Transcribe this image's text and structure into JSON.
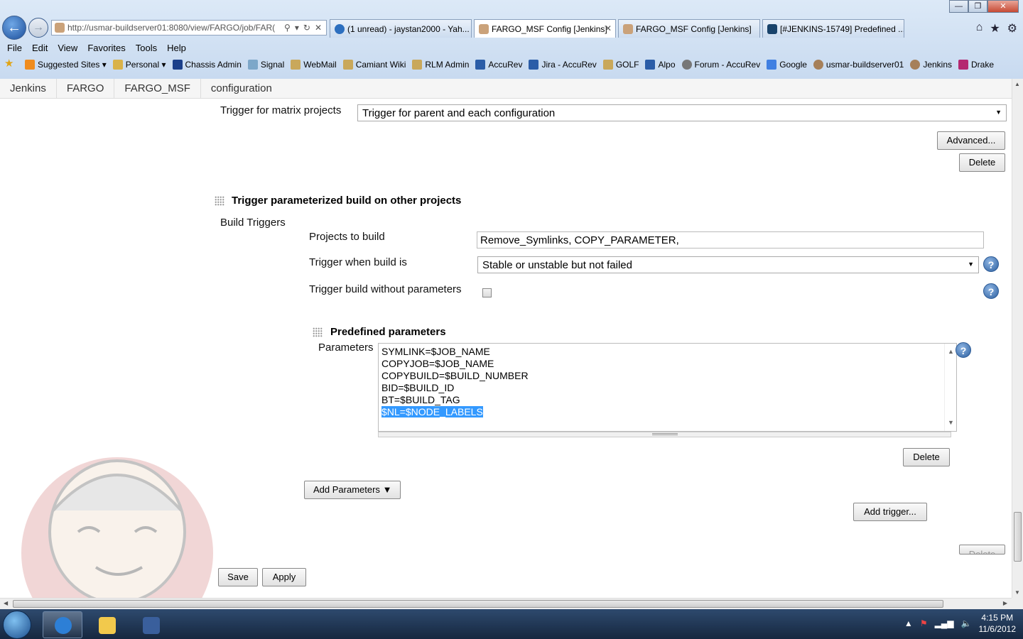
{
  "browser": {
    "address_url": "http://usmar-buildserver01:8080/view/FARGO/job/FAR(",
    "window_controls": [
      "minimize",
      "restore",
      "close"
    ],
    "tabs": [
      {
        "label": "(1 unread) - jaystan2000 - Yah...",
        "icon": "ie-icon",
        "active": false
      },
      {
        "label": "FARGO_MSF Config [Jenkins]",
        "icon": "jenkins-icon",
        "active": true
      },
      {
        "label": "FARGO_MSF Config [Jenkins]",
        "icon": "jenkins-icon",
        "active": false
      },
      {
        "label": "[#JENKINS-15749] Predefined ...",
        "icon": "jira-icon",
        "active": false
      }
    ],
    "menu": [
      "File",
      "Edit",
      "View",
      "Favorites",
      "Tools",
      "Help"
    ],
    "favorites": [
      "Suggested Sites",
      "Personal",
      "Chassis Admin",
      "Signal",
      "WebMail",
      "Camiant Wiki",
      "RLM Admin",
      "AccuRev",
      "Jira - AccuRev",
      "GOLF",
      "Alpo",
      "Forum - AccuRev",
      "Google",
      "usmar-buildserver01",
      "Jenkins",
      "Drake"
    ]
  },
  "breadcrumb": [
    "Jenkins",
    "FARGO",
    "FARGO_MSF",
    "configuration"
  ],
  "matrix": {
    "label": "Trigger for matrix projects",
    "value": "Trigger for parent and each configuration",
    "advanced_label": "Advanced...",
    "delete_label": "Delete"
  },
  "trigger_section": {
    "title": "Trigger parameterized build on other projects",
    "build_triggers_label": "Build Triggers",
    "projects_label": "Projects to build",
    "projects_value": "Remove_Symlinks, COPY_PARAMETER,",
    "when_label": "Trigger when build is",
    "when_value": "Stable or unstable but not failed",
    "without_params_label": "Trigger build without parameters",
    "without_params_checked": false
  },
  "predefined": {
    "title": "Predefined parameters",
    "params_label": "Parameters",
    "lines": [
      "SYMLINK=$JOB_NAME",
      "COPYJOB=$JOB_NAME",
      "COPYBUILD=$BUILD_NUMBER",
      "BID=$BUILD_ID",
      "BT=$BUILD_TAG",
      "$NL=$NODE_LABELS"
    ],
    "delete_label": "Delete"
  },
  "actions": {
    "add_parameters_label": "Add Parameters",
    "add_trigger_label": "Add trigger...",
    "delete_partial_label": "Delete",
    "save_label": "Save",
    "apply_label": "Apply"
  },
  "taskbar": {
    "time": "4:15 PM",
    "date": "11/6/2012"
  },
  "help_symbol": "?"
}
